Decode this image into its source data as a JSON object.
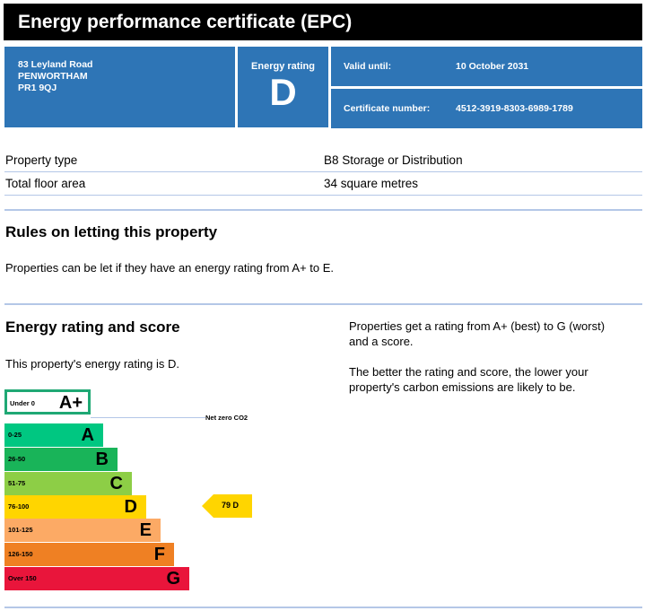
{
  "header": {
    "title": "Energy performance certificate (EPC)"
  },
  "address": {
    "line1": "83 Leyland Road",
    "line2": "PENWORTHAM",
    "line3": "PR1 9QJ"
  },
  "rating_box": {
    "label": "Energy rating",
    "rating": "D"
  },
  "valid": {
    "label": "Valid until:",
    "value": "10 October 2031"
  },
  "certificate": {
    "label": "Certificate number:",
    "value": "4512-3919-8303-6989-1789"
  },
  "property": {
    "type_label": "Property type",
    "type_value": "B8 Storage or Distribution",
    "area_label": "Total floor area",
    "area_value": "34 square metres"
  },
  "letting": {
    "heading": "Rules on letting this property",
    "text": "Properties can be let if they have an energy rating from A+ to E."
  },
  "score": {
    "heading": "Energy rating and score",
    "text": "This property's energy rating is D.",
    "right_p1_line1": "Properties get a rating from A+ (best) to G (worst)",
    "right_p1_line2": "and a score.",
    "right_p2_line1": "The better the rating and score, the lower your",
    "right_p2_line2": "property's carbon emissions are likely to be."
  },
  "scale": {
    "aplus": {
      "range": "Under 0",
      "letter": "A+",
      "color": "#1fa874"
    },
    "net_zero_label": "Net zero CO2",
    "bands": [
      {
        "range": "0-25",
        "letter": "A",
        "color": "#00c781"
      },
      {
        "range": "26-50",
        "letter": "B",
        "color": "#19b459"
      },
      {
        "range": "51-75",
        "letter": "C",
        "color": "#8dce46"
      },
      {
        "range": "76-100",
        "letter": "D",
        "color": "#ffd500"
      },
      {
        "range": "101-125",
        "letter": "E",
        "color": "#fcaa65"
      },
      {
        "range": "126-150",
        "letter": "F",
        "color": "#ef8023"
      },
      {
        "range": "Over 150",
        "letter": "G",
        "color": "#e9153b"
      }
    ],
    "current": {
      "text": "79  D",
      "color": "#ffd500"
    }
  }
}
